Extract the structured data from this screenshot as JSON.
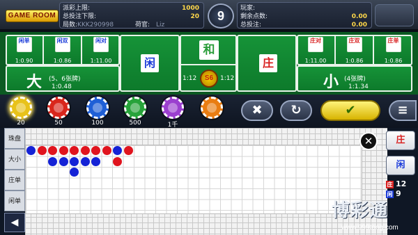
{
  "header": {
    "logo": "GAME ROOM",
    "left": [
      {
        "label": "派彩上限:",
        "value": "1000"
      },
      {
        "label": "总投注下限:",
        "value": "20"
      },
      {
        "label": "局数:",
        "value": "KKK290998",
        "extra_label": "荷官:",
        "extra_value": "Liz"
      }
    ],
    "countdown": "9",
    "right": [
      {
        "label": "玩家:",
        "value": ""
      },
      {
        "label": "剩余点数:",
        "value": "0.00"
      },
      {
        "label": "总投注:",
        "value": "0.00"
      }
    ]
  },
  "bets": {
    "player_pair_boxes": [
      {
        "label": "闲单",
        "odds": "1:0.90"
      },
      {
        "label": "闲双",
        "odds": "1:0.86"
      },
      {
        "label": "闲对",
        "odds": "1:11.00"
      }
    ],
    "big": {
      "label": "大",
      "desc": "(5、6张牌)",
      "odds": "1:0.48"
    },
    "player": {
      "label": "闲"
    },
    "tie": {
      "label": "和",
      "odds_left": "1:12",
      "odds_right": "1:12",
      "badge": "S6"
    },
    "banker": {
      "label": "庄"
    },
    "banker_pair_boxes": [
      {
        "label": "庄对",
        "odds": "1:11.00"
      },
      {
        "label": "庄双",
        "odds": "1:0.86"
      },
      {
        "label": "庄单",
        "odds": "1:0.86"
      }
    ],
    "small": {
      "label": "小",
      "desc": "(4张牌)",
      "odds": "1:1.34"
    }
  },
  "chips": [
    {
      "label": "20",
      "color": "#e8c21a"
    },
    {
      "label": "50",
      "color": "#d9261c"
    },
    {
      "label": "100",
      "color": "#1f5fd6"
    },
    {
      "label": "500",
      "color": "#27a33a"
    },
    {
      "label": "1千",
      "color": "#9b3fcf"
    },
    {
      "label": "",
      "color": "#e97d12"
    }
  ],
  "controls": {
    "cancel": "✖",
    "rebet": "↻",
    "confirm": "✔",
    "menu": "≡"
  },
  "road_tabs": [
    "珠盘",
    "大小",
    "庄单",
    "闲单"
  ],
  "sidebar": {
    "banker": "庄",
    "player": "闲"
  },
  "stats": [
    {
      "badge": "庄",
      "count": "12",
      "color": "#d81f1f"
    },
    {
      "badge": "闲",
      "count": "9",
      "color": "#1b3bd9"
    }
  ],
  "bead_road": {
    "colors": {
      "B": "#e0141e",
      "P": "#1422d6"
    },
    "columns": [
      [
        "P"
      ],
      [
        "R"
      ],
      [
        "R",
        "P"
      ],
      [
        "R",
        "P"
      ],
      [
        "R",
        "P",
        "P"
      ],
      [
        "R",
        "P"
      ],
      [
        "R",
        "P"
      ],
      [
        "R"
      ],
      [
        "P",
        "R"
      ],
      [
        "R"
      ]
    ]
  },
  "watermark": {
    "text": "博彩通",
    "url": "www.999tong.com"
  },
  "back": "◀"
}
